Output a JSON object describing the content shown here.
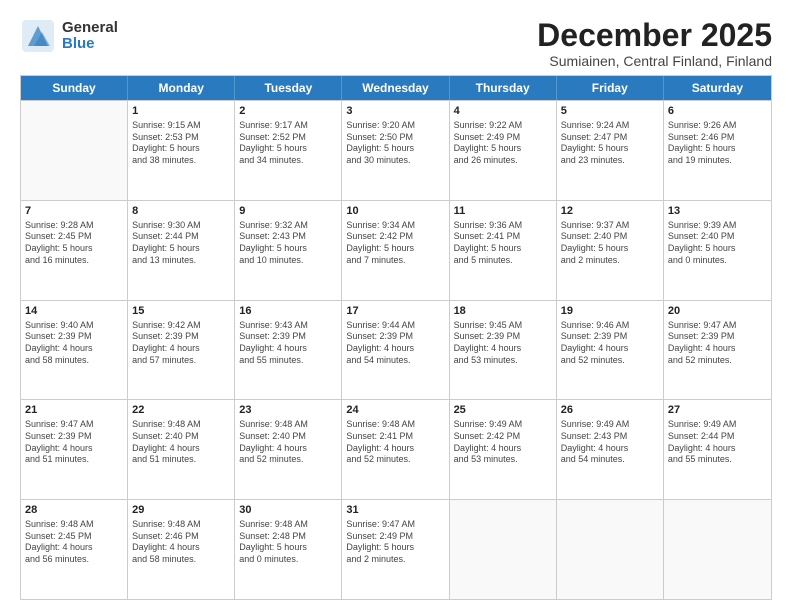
{
  "logo": {
    "general": "General",
    "blue": "Blue"
  },
  "header": {
    "month": "December 2025",
    "location": "Sumiainen, Central Finland, Finland"
  },
  "weekdays": [
    "Sunday",
    "Monday",
    "Tuesday",
    "Wednesday",
    "Thursday",
    "Friday",
    "Saturday"
  ],
  "weeks": [
    [
      {
        "day": "",
        "lines": []
      },
      {
        "day": "1",
        "lines": [
          "Sunrise: 9:15 AM",
          "Sunset: 2:53 PM",
          "Daylight: 5 hours",
          "and 38 minutes."
        ]
      },
      {
        "day": "2",
        "lines": [
          "Sunrise: 9:17 AM",
          "Sunset: 2:52 PM",
          "Daylight: 5 hours",
          "and 34 minutes."
        ]
      },
      {
        "day": "3",
        "lines": [
          "Sunrise: 9:20 AM",
          "Sunset: 2:50 PM",
          "Daylight: 5 hours",
          "and 30 minutes."
        ]
      },
      {
        "day": "4",
        "lines": [
          "Sunrise: 9:22 AM",
          "Sunset: 2:49 PM",
          "Daylight: 5 hours",
          "and 26 minutes."
        ]
      },
      {
        "day": "5",
        "lines": [
          "Sunrise: 9:24 AM",
          "Sunset: 2:47 PM",
          "Daylight: 5 hours",
          "and 23 minutes."
        ]
      },
      {
        "day": "6",
        "lines": [
          "Sunrise: 9:26 AM",
          "Sunset: 2:46 PM",
          "Daylight: 5 hours",
          "and 19 minutes."
        ]
      }
    ],
    [
      {
        "day": "7",
        "lines": [
          "Sunrise: 9:28 AM",
          "Sunset: 2:45 PM",
          "Daylight: 5 hours",
          "and 16 minutes."
        ]
      },
      {
        "day": "8",
        "lines": [
          "Sunrise: 9:30 AM",
          "Sunset: 2:44 PM",
          "Daylight: 5 hours",
          "and 13 minutes."
        ]
      },
      {
        "day": "9",
        "lines": [
          "Sunrise: 9:32 AM",
          "Sunset: 2:43 PM",
          "Daylight: 5 hours",
          "and 10 minutes."
        ]
      },
      {
        "day": "10",
        "lines": [
          "Sunrise: 9:34 AM",
          "Sunset: 2:42 PM",
          "Daylight: 5 hours",
          "and 7 minutes."
        ]
      },
      {
        "day": "11",
        "lines": [
          "Sunrise: 9:36 AM",
          "Sunset: 2:41 PM",
          "Daylight: 5 hours",
          "and 5 minutes."
        ]
      },
      {
        "day": "12",
        "lines": [
          "Sunrise: 9:37 AM",
          "Sunset: 2:40 PM",
          "Daylight: 5 hours",
          "and 2 minutes."
        ]
      },
      {
        "day": "13",
        "lines": [
          "Sunrise: 9:39 AM",
          "Sunset: 2:40 PM",
          "Daylight: 5 hours",
          "and 0 minutes."
        ]
      }
    ],
    [
      {
        "day": "14",
        "lines": [
          "Sunrise: 9:40 AM",
          "Sunset: 2:39 PM",
          "Daylight: 4 hours",
          "and 58 minutes."
        ]
      },
      {
        "day": "15",
        "lines": [
          "Sunrise: 9:42 AM",
          "Sunset: 2:39 PM",
          "Daylight: 4 hours",
          "and 57 minutes."
        ]
      },
      {
        "day": "16",
        "lines": [
          "Sunrise: 9:43 AM",
          "Sunset: 2:39 PM",
          "Daylight: 4 hours",
          "and 55 minutes."
        ]
      },
      {
        "day": "17",
        "lines": [
          "Sunrise: 9:44 AM",
          "Sunset: 2:39 PM",
          "Daylight: 4 hours",
          "and 54 minutes."
        ]
      },
      {
        "day": "18",
        "lines": [
          "Sunrise: 9:45 AM",
          "Sunset: 2:39 PM",
          "Daylight: 4 hours",
          "and 53 minutes."
        ]
      },
      {
        "day": "19",
        "lines": [
          "Sunrise: 9:46 AM",
          "Sunset: 2:39 PM",
          "Daylight: 4 hours",
          "and 52 minutes."
        ]
      },
      {
        "day": "20",
        "lines": [
          "Sunrise: 9:47 AM",
          "Sunset: 2:39 PM",
          "Daylight: 4 hours",
          "and 52 minutes."
        ]
      }
    ],
    [
      {
        "day": "21",
        "lines": [
          "Sunrise: 9:47 AM",
          "Sunset: 2:39 PM",
          "Daylight: 4 hours",
          "and 51 minutes."
        ]
      },
      {
        "day": "22",
        "lines": [
          "Sunrise: 9:48 AM",
          "Sunset: 2:40 PM",
          "Daylight: 4 hours",
          "and 51 minutes."
        ]
      },
      {
        "day": "23",
        "lines": [
          "Sunrise: 9:48 AM",
          "Sunset: 2:40 PM",
          "Daylight: 4 hours",
          "and 52 minutes."
        ]
      },
      {
        "day": "24",
        "lines": [
          "Sunrise: 9:48 AM",
          "Sunset: 2:41 PM",
          "Daylight: 4 hours",
          "and 52 minutes."
        ]
      },
      {
        "day": "25",
        "lines": [
          "Sunrise: 9:49 AM",
          "Sunset: 2:42 PM",
          "Daylight: 4 hours",
          "and 53 minutes."
        ]
      },
      {
        "day": "26",
        "lines": [
          "Sunrise: 9:49 AM",
          "Sunset: 2:43 PM",
          "Daylight: 4 hours",
          "and 54 minutes."
        ]
      },
      {
        "day": "27",
        "lines": [
          "Sunrise: 9:49 AM",
          "Sunset: 2:44 PM",
          "Daylight: 4 hours",
          "and 55 minutes."
        ]
      }
    ],
    [
      {
        "day": "28",
        "lines": [
          "Sunrise: 9:48 AM",
          "Sunset: 2:45 PM",
          "Daylight: 4 hours",
          "and 56 minutes."
        ]
      },
      {
        "day": "29",
        "lines": [
          "Sunrise: 9:48 AM",
          "Sunset: 2:46 PM",
          "Daylight: 4 hours",
          "and 58 minutes."
        ]
      },
      {
        "day": "30",
        "lines": [
          "Sunrise: 9:48 AM",
          "Sunset: 2:48 PM",
          "Daylight: 5 hours",
          "and 0 minutes."
        ]
      },
      {
        "day": "31",
        "lines": [
          "Sunrise: 9:47 AM",
          "Sunset: 2:49 PM",
          "Daylight: 5 hours",
          "and 2 minutes."
        ]
      },
      {
        "day": "",
        "lines": []
      },
      {
        "day": "",
        "lines": []
      },
      {
        "day": "",
        "lines": []
      }
    ]
  ]
}
